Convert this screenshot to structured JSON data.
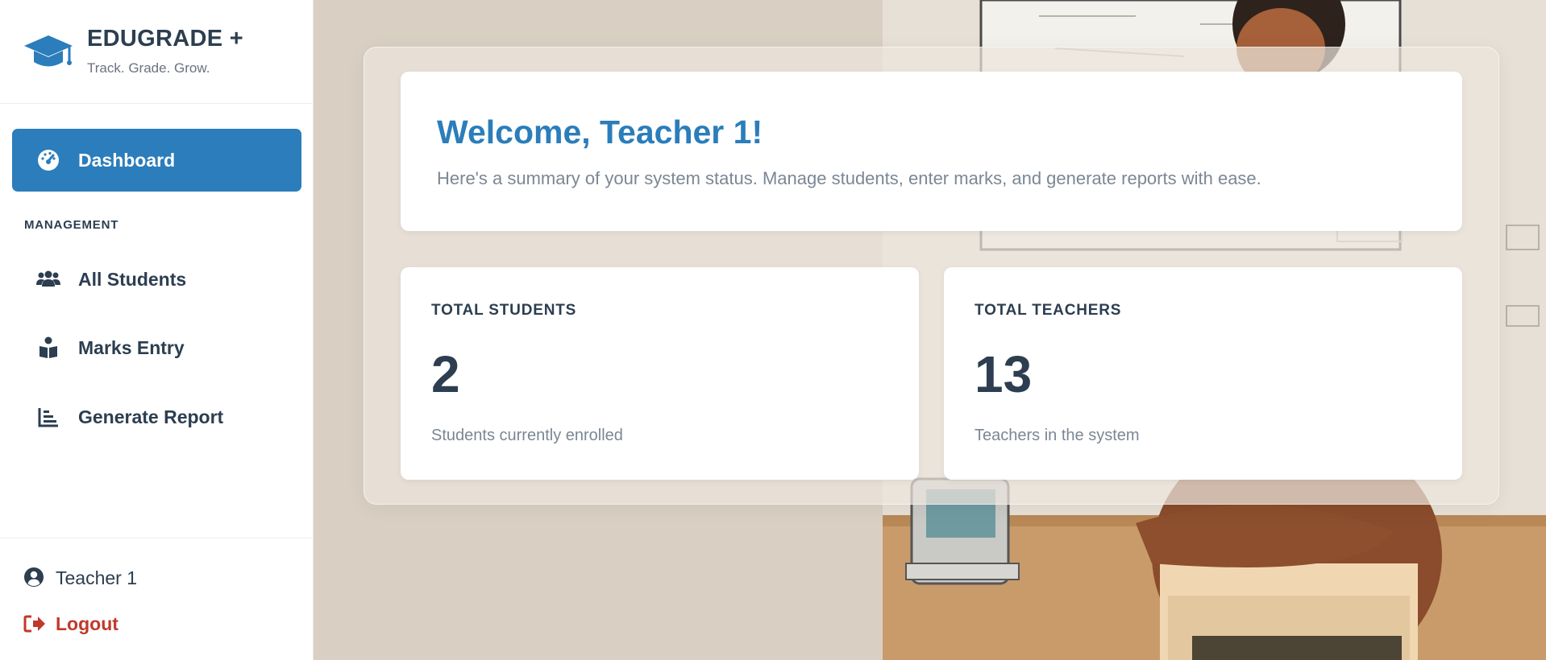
{
  "brand": {
    "name": "EDUGRADE +",
    "tagline": "Track. Grade. Grow.",
    "icon": "graduation-cap-icon",
    "color": "#2b7dbb"
  },
  "sidebar": {
    "active_item": {
      "label": "Dashboard",
      "icon": "gauge-icon"
    },
    "section_label": "MANAGEMENT",
    "items": [
      {
        "label": "All Students",
        "icon": "users-icon"
      },
      {
        "label": "Marks Entry",
        "icon": "book-reader-icon"
      },
      {
        "label": "Generate Report",
        "icon": "bar-chart-icon"
      }
    ],
    "user": {
      "name": "Teacher 1",
      "icon": "user-circle-icon"
    },
    "logout": {
      "label": "Logout",
      "icon": "sign-out-icon",
      "color": "#c0392b"
    }
  },
  "main": {
    "welcome_title": "Welcome, Teacher 1!",
    "welcome_text": "Here's a summary of your system status. Manage students, enter marks, and generate reports with ease.",
    "stats": [
      {
        "label": "TOTAL STUDENTS",
        "value": "2",
        "description": "Students currently enrolled"
      },
      {
        "label": "TOTAL TEACHERS",
        "value": "13",
        "description": "Teachers in the system"
      }
    ]
  },
  "colors": {
    "accent": "#2b7dbb",
    "text_dark": "#2c3e50",
    "text_muted": "#7b8794",
    "danger": "#c0392b"
  }
}
